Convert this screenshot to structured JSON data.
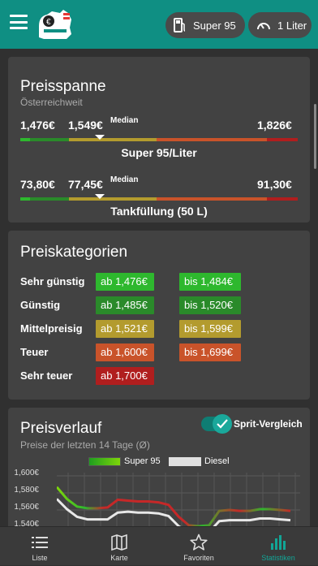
{
  "toolbar": {
    "fuel_label": "Super 95",
    "amount_label": "1 Liter"
  },
  "preisspanne": {
    "title": "Preisspanne",
    "subtitle": "Österreichweit",
    "median_label": "Median",
    "per_liter": {
      "min": "1,476€",
      "median": "1,549€",
      "max": "1,826€",
      "label": "Super 95/Liter"
    },
    "tank": {
      "min": "73,80€",
      "median": "77,45€",
      "max": "91,30€",
      "label": "Tankfüllung (50 L)"
    },
    "median_fraction": 0.21
  },
  "preiskategorien": {
    "title": "Preiskategorien",
    "rows": [
      {
        "label": "Sehr günstig",
        "from": "ab 1,476€",
        "to": "bis 1,484€",
        "color": "#2eb82e"
      },
      {
        "label": "Günstig",
        "from": "ab 1,485€",
        "to": "bis 1,520€",
        "color": "#2a8a2a"
      },
      {
        "label": "Mittelpreisig",
        "from": "ab 1,521€",
        "to": "bis 1,599€",
        "color": "#b39b2e"
      },
      {
        "label": "Teuer",
        "from": "ab 1,600€",
        "to": "bis 1,699€",
        "color": "#c9532a"
      },
      {
        "label": "Sehr teuer",
        "from": "ab 1,700€",
        "to": "",
        "color": "#b01e1e"
      }
    ]
  },
  "preisverlauf": {
    "title": "Preisverlauf",
    "subtitle": "Preise der letzten 14 Tage (Ø)",
    "toggle_label": "Sprit-Vergleich",
    "toggle_on": true
  },
  "chart_data": {
    "type": "line",
    "ylim": [
      1.54,
      1.6
    ],
    "y_ticks": [
      "1,600€",
      "1,580€",
      "1,560€",
      "1,540€"
    ],
    "series": [
      {
        "name": "Super 95",
        "values": [
          1.587,
          1.573,
          1.564,
          1.562,
          1.562,
          1.563,
          1.572,
          1.571,
          1.57,
          1.57,
          1.569,
          1.566,
          1.552,
          1.542,
          1.541,
          1.542,
          1.559,
          1.56,
          1.559,
          1.559,
          1.561,
          1.561,
          1.56,
          1.559
        ]
      },
      {
        "name": "Diesel",
        "values": [
          1.573,
          1.561,
          1.552,
          1.549,
          1.549,
          1.549,
          1.557,
          1.558,
          1.557,
          1.557,
          1.556,
          1.553,
          1.541,
          1.534,
          1.533,
          1.534,
          1.547,
          1.548,
          1.548,
          1.548,
          1.55,
          1.55,
          1.549,
          1.548
        ]
      }
    ]
  },
  "nav": [
    {
      "label": "Liste",
      "icon": "list-icon",
      "active": false
    },
    {
      "label": "Karte",
      "icon": "map-icon",
      "active": false
    },
    {
      "label": "Favoriten",
      "icon": "star-icon",
      "active": false
    },
    {
      "label": "Statistiken",
      "icon": "bar-chart-icon",
      "active": true
    }
  ]
}
